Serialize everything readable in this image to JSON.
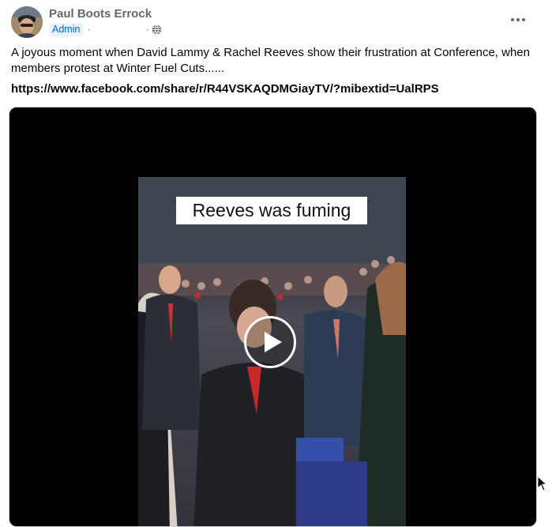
{
  "post": {
    "author": "Paul Boots Errock",
    "role_badge": "Admin",
    "separator": "·",
    "text": "A joyous moment when David Lammy & Rachel Reeves show their frustration at Conference, when members protest at Winter Fuel Cuts......",
    "link": "https://www.facebook.com/share/r/R44VSKAQDMGiayTV/?mibextid=UalRPS",
    "audience_icon": "globe-icon",
    "menu_icon": "more-options-icon"
  },
  "video": {
    "caption": "Reeves was fuming",
    "play_icon": "play-icon"
  },
  "colors": {
    "badge_bg": "#e7f3ff",
    "badge_text": "#0064d1",
    "meta_gray": "#65676b",
    "video_bg": "#000000"
  }
}
